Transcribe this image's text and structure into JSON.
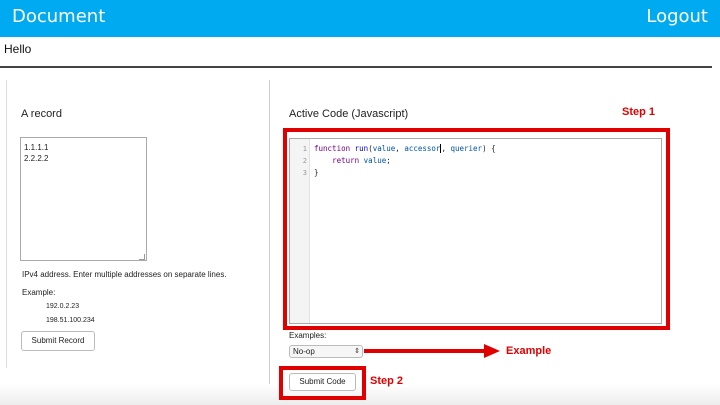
{
  "header": {
    "title": "Document",
    "logout_label": "Logout"
  },
  "greeting": "Hello",
  "left_panel": {
    "title": "A record",
    "records_value": "1.1.1.1\n2.2.2.2",
    "help_text": "IPv4 address. Enter multiple addresses on separate lines.",
    "example_label": "Example:",
    "example_ips": [
      "192.0.2.23",
      "198.51.100.234"
    ],
    "submit_label": "Submit Record"
  },
  "right_panel": {
    "title": "Active Code (Javascript)",
    "line_numbers": [
      "1",
      "2",
      "3"
    ],
    "code": {
      "kw_function": "function",
      "fn_name": "run",
      "paren_open": "(",
      "param_value": "value",
      "comma1": ", ",
      "param_accessor": "accessor",
      "comma2": ", ",
      "param_querier": "querier",
      "paren_close": ") {",
      "kw_return": "return",
      "return_value": "value",
      "semicolon": ";",
      "close_brace": "}"
    },
    "examples_label": "Examples:",
    "examples_selected": "No-op",
    "submit_label": "Submit Code"
  },
  "annotations": {
    "step1": "Step 1",
    "step2": "Step 2",
    "example": "Example"
  },
  "colors": {
    "header_bg": "#00aaf0",
    "annotation_red": "#e00000"
  }
}
